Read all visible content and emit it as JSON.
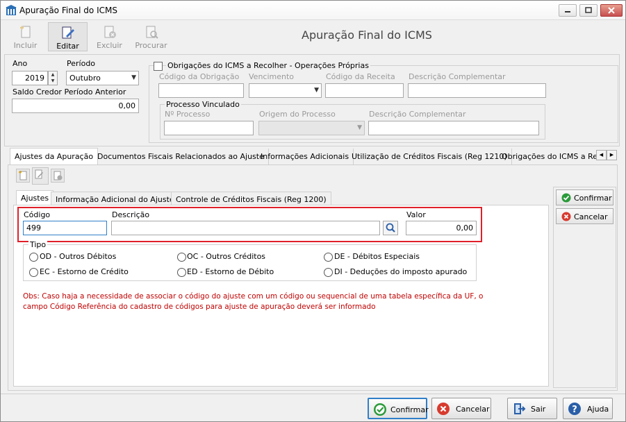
{
  "window": {
    "title": "Apuração Final do ICMS"
  },
  "toolbar": {
    "incluir": "Incluir",
    "editar": "Editar",
    "excluir": "Excluir",
    "procurar": "Procurar"
  },
  "header": {
    "title": "Apuração Final do ICMS"
  },
  "period": {
    "ano_label": "Ano",
    "ano_value": "2019",
    "periodo_label": "Período",
    "periodo_value": "Outubro",
    "saldo_label": "Saldo Credor Período Anterior",
    "saldo_value": "0,00"
  },
  "obrigacoes": {
    "checkbox_label": "Obrigações do ICMS a Recolher - Operações Próprias",
    "checked": false,
    "codigo_obrigacao_label": "Código da Obrigação",
    "vencimento_label": "Vencimento",
    "codigo_receita_label": "Código da Receita",
    "descricao_complementar_label": "Descrição Complementar",
    "processo_title": "Processo Vinculado",
    "numero_processo_label": "Nº Processo",
    "origem_processo_label": "Origem do Processo",
    "descricao_complementar2_label": "Descrição Complementar"
  },
  "tabs": [
    {
      "label": "Ajustes da Apuração",
      "active": true
    },
    {
      "label": "Documentos Fiscais Relacionados ao Ajuste"
    },
    {
      "label": "Informações Adicionais"
    },
    {
      "label": "Utilização de Créditos Fiscais (Reg 1210)"
    },
    {
      "label": "Obrigações do ICMS a Rec"
    }
  ],
  "subtabs": [
    {
      "label": "Ajustes",
      "active": true
    },
    {
      "label": "Informação Adicional do Ajuste"
    },
    {
      "label": "Controle de Créditos Fiscais (Reg 1200)"
    }
  ],
  "ajuste": {
    "codigo_label": "Código",
    "codigo_value": "499",
    "descricao_label": "Descrição",
    "descricao_value": "",
    "valor_label": "Valor",
    "valor_value": "0,00",
    "tipo_label": "Tipo",
    "tipos": [
      "OD - Outros Débitos",
      "OC - Outros Créditos",
      "DE - Débitos Especiais",
      "EC - Estorno de Crédito",
      "ED - Estorno de Débito",
      "DI - Deduções do imposto apurado"
    ],
    "obs_line1": "Obs: Caso haja a necessidade de associar o código do ajuste com um código ou sequencial de uma tabela específica da UF, o",
    "obs_line2": "campo Código Referência do cadastro de códigos para ajuste de apuração deverá ser informado"
  },
  "side_buttons": {
    "confirmar": "Confirmar",
    "cancelar": "Cancelar"
  },
  "bottom": {
    "confirmar": "Confirmar",
    "cancelar": "Cancelar",
    "sair": "Sair",
    "ajuda": "Ajuda"
  },
  "colors": {
    "accent": "#2f7fc9",
    "highlight": "#e0202a",
    "obs_text": "#c00000",
    "confirm_green": "#2a9a3a",
    "cancel_red": "#d83a2e"
  }
}
